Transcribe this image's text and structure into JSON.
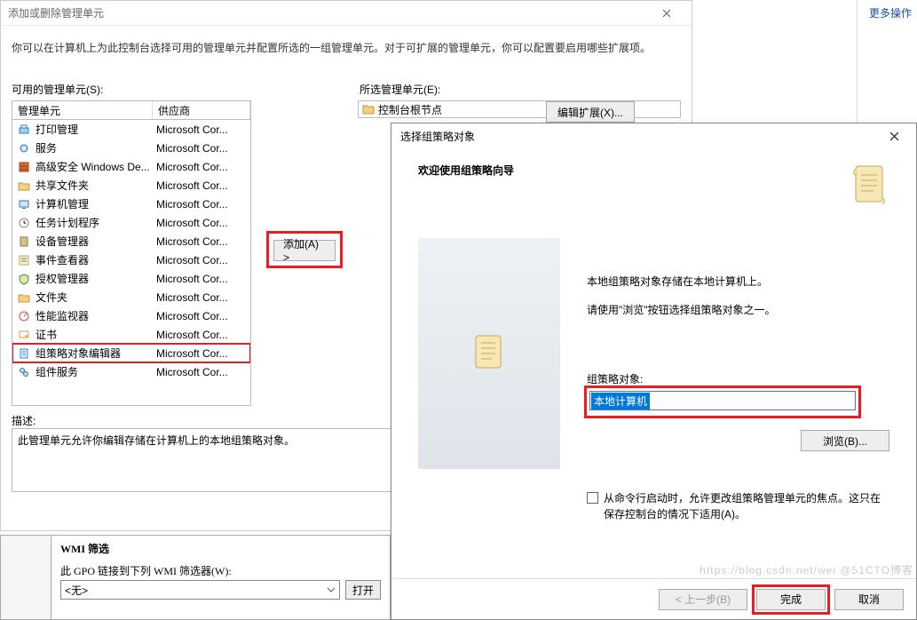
{
  "side": {
    "more_actions": "更多操作"
  },
  "dlg1": {
    "title": "添加或删除管理单元",
    "desc": "你可以在计算机上为此控制台选择可用的管理单元并配置所选的一组管理单元。对于可扩展的管理单元，你可以配置要启用哪些扩展项。",
    "available_label": "可用的管理单元(S):",
    "selected_label": "所选管理单元(E):",
    "console_root": "控制台根节点",
    "col_snapin": "管理单元",
    "col_vendor": "供应商",
    "add_btn": "添加(A) >",
    "edit_ext_btn": "编辑扩展(X)...",
    "desc_section": "描述:",
    "desc_text": "此管理单元允许你编辑存储在计算机上的本地组策略对象。",
    "snapins": [
      {
        "name": "打印管理",
        "vendor": "Microsoft Cor...",
        "icon": "printer"
      },
      {
        "name": "服务",
        "vendor": "Microsoft Cor...",
        "icon": "gears"
      },
      {
        "name": "高级安全 Windows De...",
        "vendor": "Microsoft Cor...",
        "icon": "firewall"
      },
      {
        "name": "共享文件夹",
        "vendor": "Microsoft Cor...",
        "icon": "folder-share"
      },
      {
        "name": "计算机管理",
        "vendor": "Microsoft Cor...",
        "icon": "computer"
      },
      {
        "name": "任务计划程序",
        "vendor": "Microsoft Cor...",
        "icon": "clock"
      },
      {
        "name": "设备管理器",
        "vendor": "Microsoft Cor...",
        "icon": "device"
      },
      {
        "name": "事件查看器",
        "vendor": "Microsoft Cor...",
        "icon": "event"
      },
      {
        "name": "授权管理器",
        "vendor": "Microsoft Cor...",
        "icon": "auth"
      },
      {
        "name": "文件夹",
        "vendor": "Microsoft Cor...",
        "icon": "folder"
      },
      {
        "name": "性能监视器",
        "vendor": "Microsoft Cor...",
        "icon": "perf"
      },
      {
        "name": "证书",
        "vendor": "Microsoft Cor...",
        "icon": "cert"
      },
      {
        "name": "组策略对象编辑器",
        "vendor": "Microsoft Cor...",
        "icon": "gpo",
        "selected": true
      },
      {
        "name": "组件服务",
        "vendor": "Microsoft Cor...",
        "icon": "component"
      }
    ]
  },
  "bottom": {
    "header": "WMI 筛选",
    "label": "此 GPO 链接到下列 WMI 筛选器(W):",
    "value": "<无>",
    "open": "打开"
  },
  "dlg2": {
    "title": "选择组策略对象",
    "welcome": "欢迎使用组策略向导",
    "line1": "本地组策略对象存储在本地计算机上。",
    "line2": "请使用\"浏览\"按钮选择组策略对象之一。",
    "field_label": "组策略对象:",
    "field_value": "本地计算机",
    "browse": "浏览(B)...",
    "checkbox_text": "从命令行启动时，允许更改组策略管理单元的焦点。这只在保存控制台的情况下适用(A)。",
    "back": "< 上一步(B)",
    "finish": "完成",
    "cancel": "取消"
  },
  "watermark": "https://blog.csdn.net/wei  @51CTO博客"
}
